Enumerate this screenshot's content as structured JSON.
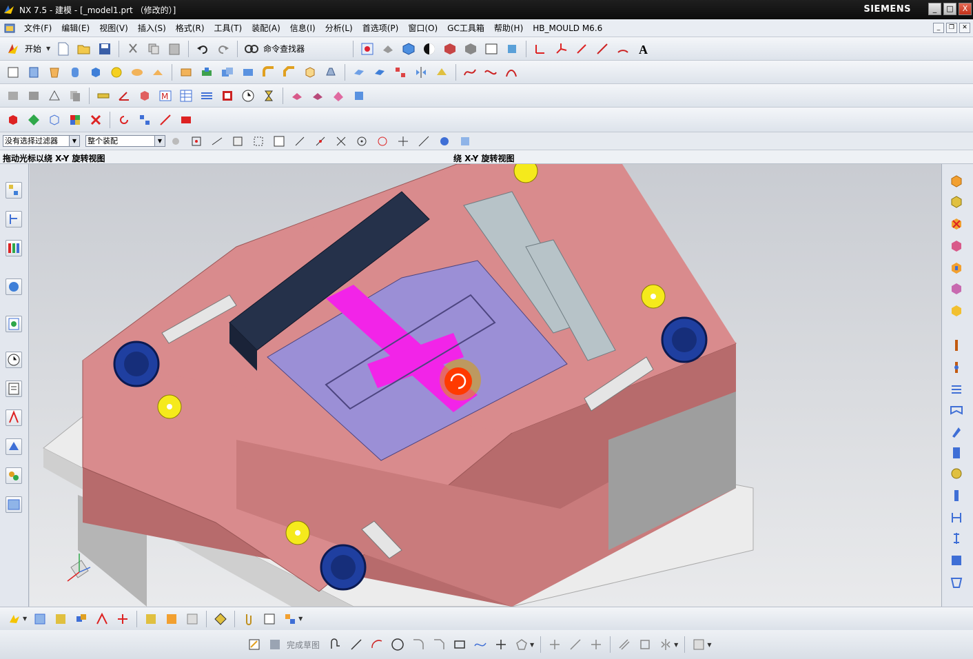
{
  "window": {
    "title": "NX 7.5 - 建模 - [_model1.prt （修改的）]",
    "brand": "SIEMENS",
    "controls": [
      "_",
      "□",
      "X"
    ]
  },
  "menu": {
    "items": [
      "文件(F)",
      "编辑(E)",
      "视图(V)",
      "插入(S)",
      "格式(R)",
      "工具(T)",
      "装配(A)",
      "信息(I)",
      "分析(L)",
      "首选项(P)",
      "窗口(O)",
      "GC工具箱",
      "帮助(H)",
      "HB_MOULD M6.6"
    ]
  },
  "standard_toolbar": {
    "start_label": "开始",
    "command_finder_label": "命令查找器"
  },
  "selection_bar": {
    "filter_value": "没有选择过滤器",
    "scope_value": "整个装配"
  },
  "cue_line": {
    "prompt": "拖动光标以绕 X-Y 旋转视图",
    "status": "绕 X-Y 旋转视图"
  },
  "sketch_toolbar": {
    "finish_label": "完成草图"
  },
  "colors": {
    "mold_plate": "#d98b8d",
    "mold_plate_dark": "#b2655f",
    "cavity_insert": "#9b8fd6",
    "highlight": "#f224e8",
    "guide_bushing": "#1f3fa0",
    "locating_ring": "#f5ea1c",
    "base_plate": "#e9e9e9",
    "side_rail": "#25314a"
  },
  "icons": {
    "toolbar_row1": [
      "start-icon",
      "new-icon",
      "open-icon",
      "save-icon",
      "cut-icon",
      "copy-icon",
      "paste-icon",
      "undo-icon",
      "redo-icon",
      "command-finder-icon"
    ],
    "left_resource_bar": [
      "assembly-navigator-icon",
      "constraint-navigator-icon",
      "part-navigator-icon",
      "reuse-library-icon",
      "web-browser-icon",
      "history-icon",
      "process-studio-icon",
      "roles-icon",
      "system-materials-icon",
      "palettes-icon"
    ],
    "right_bar": [
      "mold-wizard-init-icon",
      "workpiece-icon",
      "layout-icon",
      "mold-tools-icon",
      "parting-icon",
      "moldbase-icon",
      "standard-parts-icon",
      "ejector-pin-icon",
      "sub-insert-icon",
      "slider-lifter-icon",
      "cooling-icon",
      "gate-icon",
      "runner-icon",
      "electrode-icon",
      "trim-icon",
      "pocket-icon",
      "drawing-icon",
      "bom-icon"
    ]
  }
}
